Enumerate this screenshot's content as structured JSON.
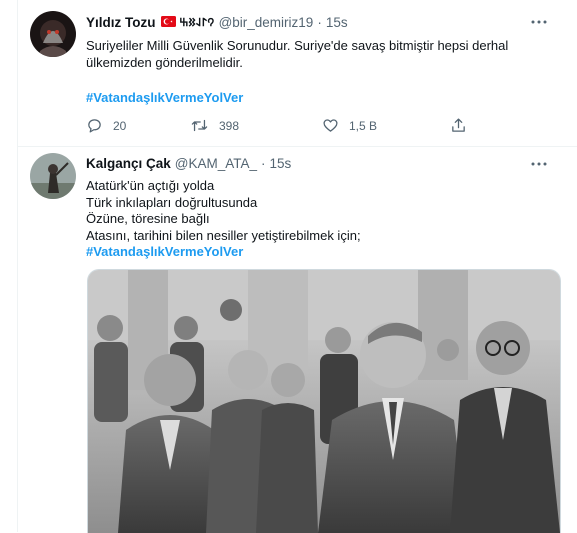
{
  "tweets": [
    {
      "name": "Yıldız Tozu",
      "runes": "𐰘𐰃𐰞𐰑𐰕",
      "handle": "@bir_demiriz19",
      "dot": "·",
      "time": "15s",
      "text": "Suriyeliler Milli Güvenlik Sorunudur. Suriye'de savaş bitmiştir hepsi derhal ülkemizden gönderilmelidir.",
      "hashtag": "#VatandaşlıkVermeYolVer",
      "replies": "20",
      "retweets": "398",
      "likes": "1,5 B"
    },
    {
      "name": "Kalgançı Çak",
      "handle": "@KAM_ATA_",
      "dot": "·",
      "time": "15s",
      "lines": [
        "Atatürk'ün açtığı yolda",
        "Türk inkılapları doğrultusunda",
        "Özüne, töresine bağlı",
        "Atasını, tarihini bilen nesiller yetiştirebilmek için;"
      ],
      "hashtag": "#VatandaşlıkVermeYolVer"
    }
  ],
  "icons": {
    "more": "more-icon",
    "reply": "reply-icon",
    "retweet": "retweet-icon",
    "like": "heart-icon",
    "share": "share-icon"
  },
  "colors": {
    "link": "#1d9bf0",
    "secondary": "#536471",
    "flag_red": "#e30a17"
  }
}
